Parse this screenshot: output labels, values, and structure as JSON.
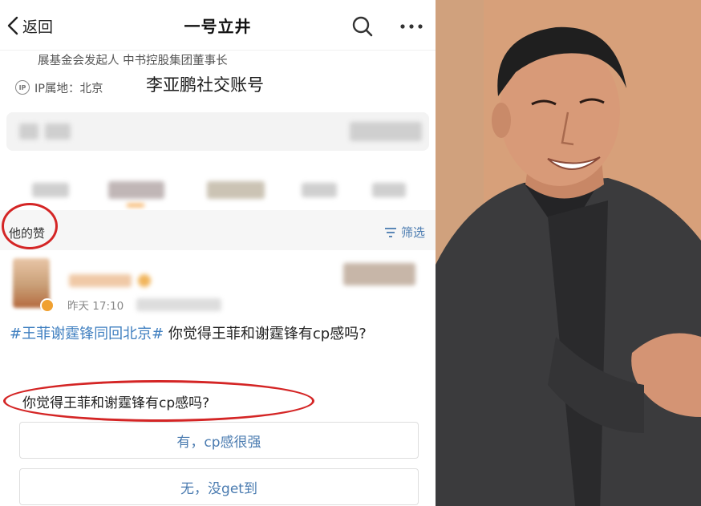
{
  "nav": {
    "back_label": "返回",
    "title": "一号立井"
  },
  "profile": {
    "bio_line": "展基金会发起人  中书控股集团董事长",
    "ip_badge": "IP",
    "ip_location": "IP属地：北京"
  },
  "caption": "李亚鹏社交账号",
  "likes": {
    "title": "他的赞",
    "filter_label": "筛选"
  },
  "post": {
    "time": "昨天 17:10",
    "hashtag": "#王菲谢霆锋同回北京#",
    "text": " 你觉得王菲和谢霆锋有cp感吗?",
    "poll_question": "你觉得王菲和谢霆锋有cp感吗?",
    "options": [
      "有，cp感很强",
      "无，没get到"
    ]
  },
  "colors": {
    "link_blue": "#3f7fc0",
    "annotation_red": "#d42525"
  }
}
